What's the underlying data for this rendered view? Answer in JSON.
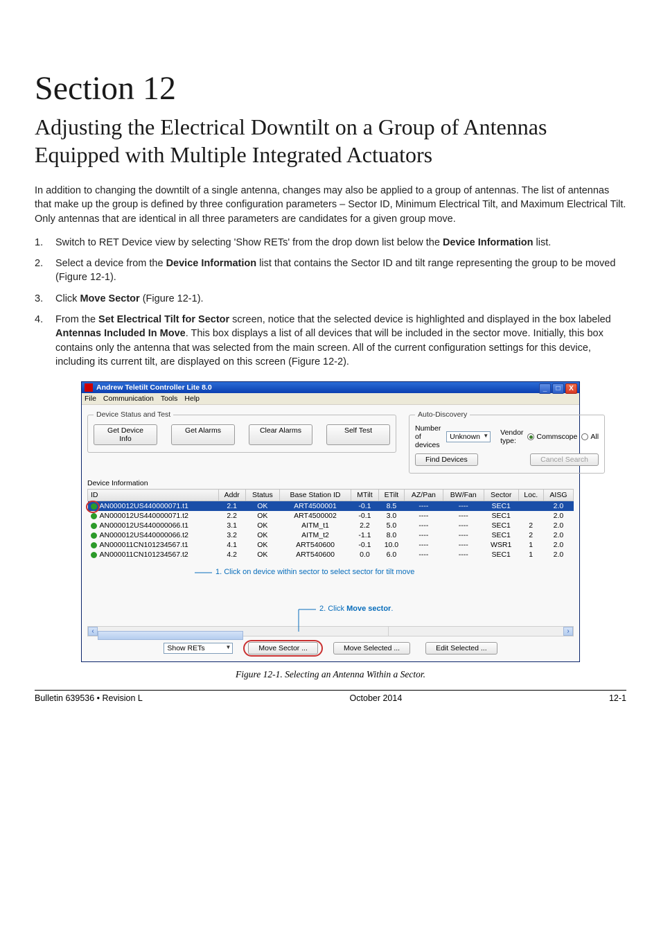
{
  "section": {
    "number": "Section 12",
    "title": "Adjusting the Electrical Downtilt on a Group of Antennas Equipped with Multiple Integrated Actuators"
  },
  "intro": "In addition to changing the downtilt of a single antenna, changes may also be applied to a group of antennas. The list of antennas that make up the group is defined by three configuration parameters – Sector ID, Minimum Electrical Tilt, and Maximum Electrical Tilt. Only antennas that are identical in all three parameters are candidates for a given group move.",
  "steps": {
    "s1a": "Switch to RET Device view by selecting 'Show RETs' from the drop down list below the ",
    "s1b": "Device Information",
    "s1c": " list.",
    "s2a": "Select a device from the ",
    "s2b": "Device Information",
    "s2c": " list that contains the Sector ID and tilt range representing the group to be moved (Figure 12-1).",
    "s3a": "Click ",
    "s3b": "Move Sector",
    "s3c": " (Figure 12-1).",
    "s4a": "From the ",
    "s4b": "Set Electrical Tilt for Sector",
    "s4c": " screen, notice that the selected device is highlighted and displayed in the box labeled ",
    "s4d": "Antennas Included In Move",
    "s4e": ". This box displays a list of all devices that will be included in the sector move. Initially, this box contains only the antenna that was selected from the main screen. All of the current configuration settings for this device, including its current tilt, are displayed on this screen (Figure 12-2)."
  },
  "app": {
    "title": "Andrew Teletilt Controller Lite 8.0",
    "menu": [
      "File",
      "Communication",
      "Tools",
      "Help"
    ],
    "groupbox_status": "Device Status and Test",
    "buttons": {
      "get_device_info": "Get Device Info",
      "get_alarms": "Get Alarms",
      "clear_alarms": "Clear Alarms",
      "self_test": "Self Test",
      "find_devices": "Find Devices",
      "cancel_search": "Cancel Search",
      "move_sector": "Move Sector ...",
      "move_selected": "Move Selected ...",
      "edit_selected": "Edit Selected ..."
    },
    "groupbox_auto": "Auto-Discovery",
    "auto": {
      "num_devices_label": "Number of devices",
      "num_devices_value": "Unknown",
      "vendor_label": "Vendor type:",
      "vendor_commscope": "Commscope",
      "vendor_all": "All"
    },
    "device_info_label": "Device Information",
    "table": {
      "headers": [
        "ID",
        "Addr",
        "Status",
        "Base Station ID",
        "MTilt",
        "ETilt",
        "AZ/Pan",
        "BW/Fan",
        "Sector",
        "Loc.",
        "AISG"
      ],
      "rows": [
        {
          "id": "AN000012US440000071.t1",
          "addr": "2.1",
          "status": "OK",
          "bs": "ART4500001",
          "mtilt": "-0.1",
          "etilt": "8.5",
          "az": "----",
          "bw": "----",
          "sector": "SEC1",
          "loc": "",
          "aisg": "2.0",
          "sel": true
        },
        {
          "id": "AN000012US440000071.t2",
          "addr": "2.2",
          "status": "OK",
          "bs": "ART4500002",
          "mtilt": "-0.1",
          "etilt": "3.0",
          "az": "----",
          "bw": "----",
          "sector": "SEC1",
          "loc": "",
          "aisg": "2.0"
        },
        {
          "id": "AN000012US440000066.t1",
          "addr": "3.1",
          "status": "OK",
          "bs": "AITM_t1",
          "mtilt": "2.2",
          "etilt": "5.0",
          "az": "----",
          "bw": "----",
          "sector": "SEC1",
          "loc": "2",
          "aisg": "2.0"
        },
        {
          "id": "AN000012US440000066.t2",
          "addr": "3.2",
          "status": "OK",
          "bs": "AITM_t2",
          "mtilt": "-1.1",
          "etilt": "8.0",
          "az": "----",
          "bw": "----",
          "sector": "SEC1",
          "loc": "2",
          "aisg": "2.0"
        },
        {
          "id": "AN000011CN101234567.t1",
          "addr": "4.1",
          "status": "OK",
          "bs": "ART540600",
          "mtilt": "-0.1",
          "etilt": "10.0",
          "az": "----",
          "bw": "----",
          "sector": "WSR1",
          "loc": "1",
          "aisg": "2.0"
        },
        {
          "id": "AN000011CN101234567.t2",
          "addr": "4.2",
          "status": "OK",
          "bs": "ART540600",
          "mtilt": "0.0",
          "etilt": "6.0",
          "az": "----",
          "bw": "----",
          "sector": "SEC1",
          "loc": "1",
          "aisg": "2.0"
        }
      ]
    },
    "show_rets": "Show RETs"
  },
  "annotations": {
    "a1": "1. Click on device within sector to select sector for tilt move",
    "a2a": "2. Click ",
    "a2b": "Move sector",
    "a2c": "."
  },
  "figure_caption": "Figure 12-1. Selecting an Antenna Within a Sector.",
  "footer": {
    "left": "Bulletin 639536  •  Revision L",
    "center": "October 2014",
    "right": "12-1"
  },
  "winbtns": {
    "min": "_",
    "max": "□",
    "close": "X"
  }
}
